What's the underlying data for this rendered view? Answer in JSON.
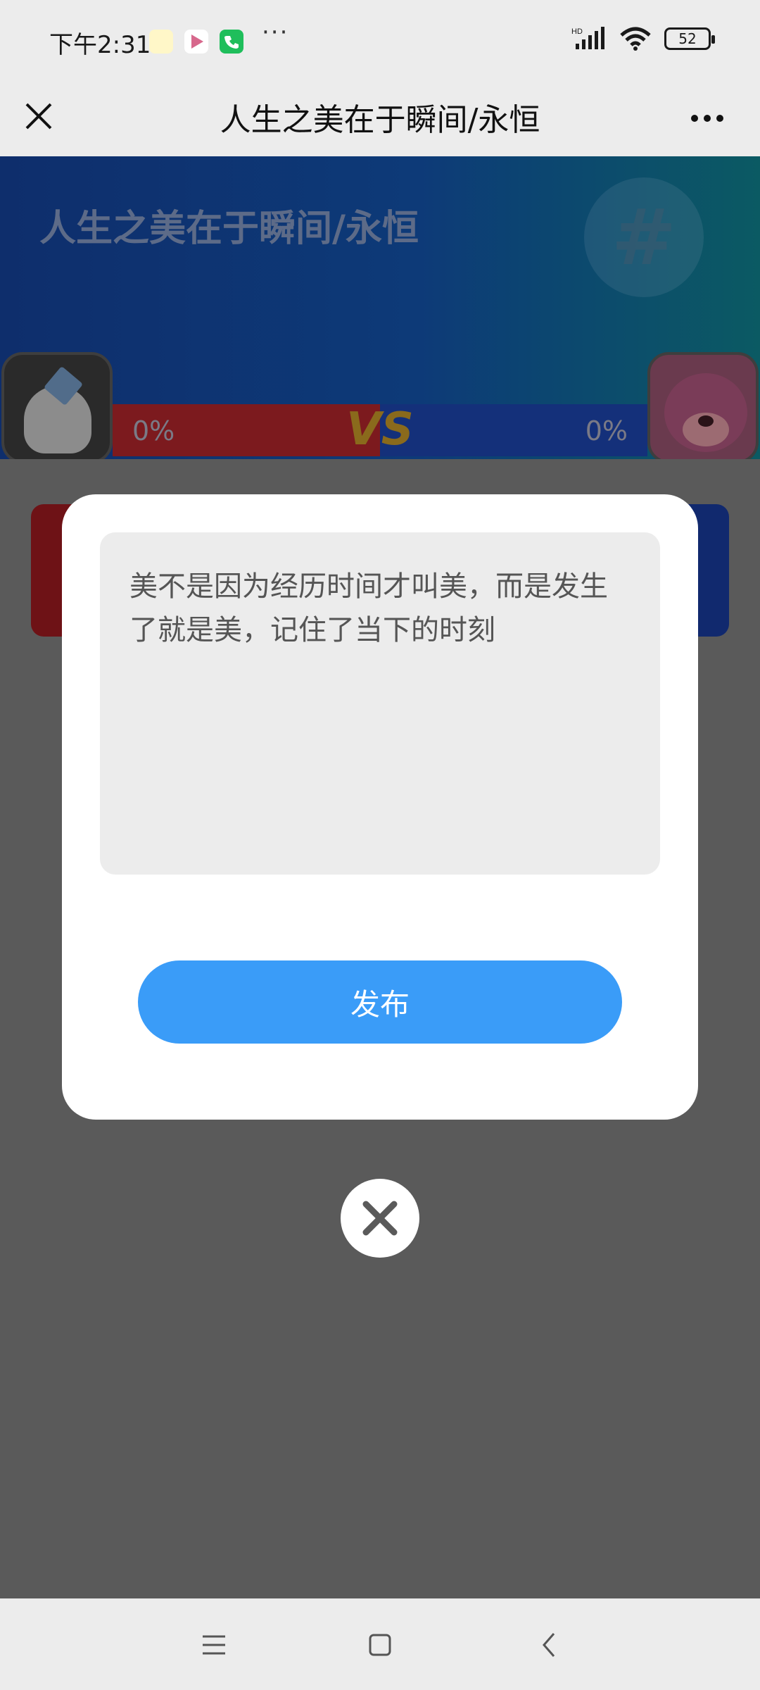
{
  "status_bar": {
    "time": "下午2:31",
    "overflow": "···",
    "network": "HD",
    "battery": "52"
  },
  "title_bar": {
    "title": "人生之美在于瞬间/永恒"
  },
  "banner": {
    "title": "人生之美在于瞬间/永恒",
    "badge_symbol": "#",
    "vs_label": "VS",
    "left_percent": "0%",
    "right_percent": "0%"
  },
  "modal": {
    "comment_text": "美不是因为经历时间才叫美，而是发生了就是美，记住了当下的时刻",
    "publish_label": "发布"
  },
  "colors": {
    "publish_button": "#3a9cf8",
    "modal_background": "#ffffff",
    "overlay": "#5a5a5a",
    "red_side": "#7c1a1e",
    "blue_side": "#14307a"
  },
  "icons": {
    "close": "close-icon",
    "more": "more-dots-icon",
    "modal_close": "modal-close-icon",
    "nav_menu": "menu-icon",
    "nav_home": "home-icon",
    "nav_back": "back-icon"
  }
}
